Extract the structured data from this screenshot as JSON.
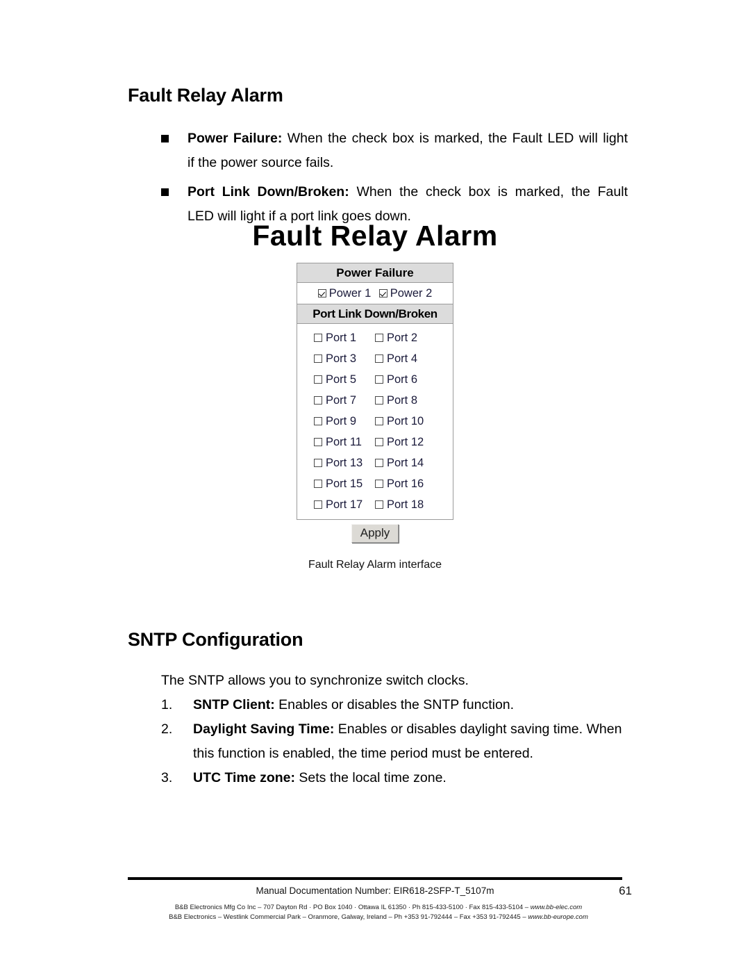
{
  "document": {
    "page_number": "61",
    "manual_line": "Manual Documentation Number: EIR618-2SFP-T_5107m"
  },
  "sections": {
    "fault_relay": {
      "heading": "Fault Relay Alarm",
      "bullets": [
        {
          "term": "Power Failure:",
          "line1": " When the check box is marked, the Fault LED will light",
          "line2": "if the power source fails."
        },
        {
          "term": "Port Link Down/Broken:",
          "line1": "  When the check box is marked, the Fault",
          "line2": "LED will light if a port link goes down."
        }
      ]
    },
    "sntp": {
      "heading": "SNTP Configuration",
      "intro": "The SNTP allows you to synchronize switch clocks.",
      "items": [
        {
          "number": "1.",
          "term": "SNTP Client:",
          "text": " Enables or disables the SNTP function."
        },
        {
          "number": "2.",
          "term": "Daylight Saving Time:",
          "text": " Enables or disables daylight saving time. When this function is enabled, the time period must be entered."
        },
        {
          "number": "3.",
          "term": "UTC Time zone:",
          "text": " Sets the local time zone."
        }
      ]
    }
  },
  "figure": {
    "title": "Fault Relay Alarm",
    "caption": "Fault Relay Alarm interface",
    "power_failure": {
      "header": "Power Failure",
      "checkboxes": [
        {
          "label": "Power 1",
          "checked": true
        },
        {
          "label": "Power 2",
          "checked": true
        }
      ]
    },
    "port_link": {
      "header": "Port Link Down/Broken",
      "rows": [
        [
          {
            "label": "Port 1",
            "checked": false
          },
          {
            "label": "Port 2",
            "checked": false
          }
        ],
        [
          {
            "label": "Port 3",
            "checked": false
          },
          {
            "label": "Port 4",
            "checked": false
          }
        ],
        [
          {
            "label": "Port 5",
            "checked": false
          },
          {
            "label": "Port 6",
            "checked": false
          }
        ],
        [
          {
            "label": "Port 7",
            "checked": false
          },
          {
            "label": "Port 8",
            "checked": false
          }
        ],
        [
          {
            "label": "Port 9",
            "checked": false
          },
          {
            "label": "Port 10",
            "checked": false
          }
        ],
        [
          {
            "label": "Port 11",
            "checked": false
          },
          {
            "label": "Port 12",
            "checked": false
          }
        ],
        [
          {
            "label": "Port 13",
            "checked": false
          },
          {
            "label": "Port 14",
            "checked": false
          }
        ],
        [
          {
            "label": "Port 15",
            "checked": false
          },
          {
            "label": "Port 16",
            "checked": false
          }
        ],
        [
          {
            "label": "Port 17",
            "checked": false
          },
          {
            "label": "Port 18",
            "checked": false
          }
        ]
      ]
    },
    "apply_label": "Apply"
  },
  "footer": {
    "address_line_1": "B&B Electronics Mfg Co Inc – 707 Dayton Rd · PO Box 1040 · Ottawa IL 61350 · Ph 815-433-5100 · Fax 815-433-5104 – ",
    "address_line_1_url": "www.bb-elec.com",
    "address_line_2": "B&B Electronics – Westlink Commercial Park – Oranmore, Galway, Ireland – Ph +353 91-792444 – Fax +353 91-792445 – ",
    "address_line_2_url": "www.bb-europe.com"
  },
  "colors": {
    "header_bg": "#dcdcdc",
    "border": "#9a9a9a",
    "label_text": "#1a1a3a",
    "button_bg": "#dcdad5"
  }
}
